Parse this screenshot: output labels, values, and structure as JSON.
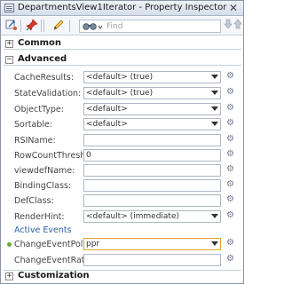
{
  "window": {
    "title": "DepartmentsView1Iterator - Property Inspector",
    "close_glyph": "✕"
  },
  "toolbar": {
    "search_placeholder": "Find",
    "icons": [
      "bind-icon",
      "pin-icon",
      "edit-icon",
      "binoculars-icon",
      "search-down-icon",
      "search-up-icon"
    ]
  },
  "sections": {
    "common": {
      "title": "Common",
      "toggle": "+"
    },
    "advanced": {
      "title": "Advanced",
      "toggle": "−"
    },
    "customization": {
      "title": "Customization",
      "toggle": "+"
    }
  },
  "advanced_rows": [
    {
      "label": "CacheResults:",
      "value": "<default> (true)",
      "type": "combo"
    },
    {
      "label": "StateValidation:",
      "value": "<default> (true)",
      "type": "combo"
    },
    {
      "label": "ObjectType:",
      "value": "<default>",
      "type": "combo"
    },
    {
      "label": "Sortable:",
      "value": "<default>",
      "type": "combo"
    },
    {
      "label": "RSIName:",
      "value": "",
      "type": "text"
    },
    {
      "label": "RowCountThreshold:",
      "value": "0",
      "type": "text"
    },
    {
      "label": "viewdefName:",
      "value": "",
      "type": "text"
    },
    {
      "label": "BindingClass:",
      "value": "",
      "type": "text"
    },
    {
      "label": "DefClass:",
      "value": "",
      "type": "text"
    },
    {
      "label": "RenderHint:",
      "value": "<default> (immediate)",
      "type": "combo"
    }
  ],
  "active_events": {
    "heading": "Active Events",
    "rows": [
      {
        "label": "ChangeEventPolicy:",
        "value": "ppr",
        "type": "combo",
        "highlight": true,
        "bullet": true
      },
      {
        "label": "ChangeEventRate:",
        "value": "",
        "type": "text"
      }
    ]
  },
  "colors": {
    "accent": "#2c62a8",
    "highlight_border": "#e0a030",
    "bullet": "#6aa83a"
  }
}
